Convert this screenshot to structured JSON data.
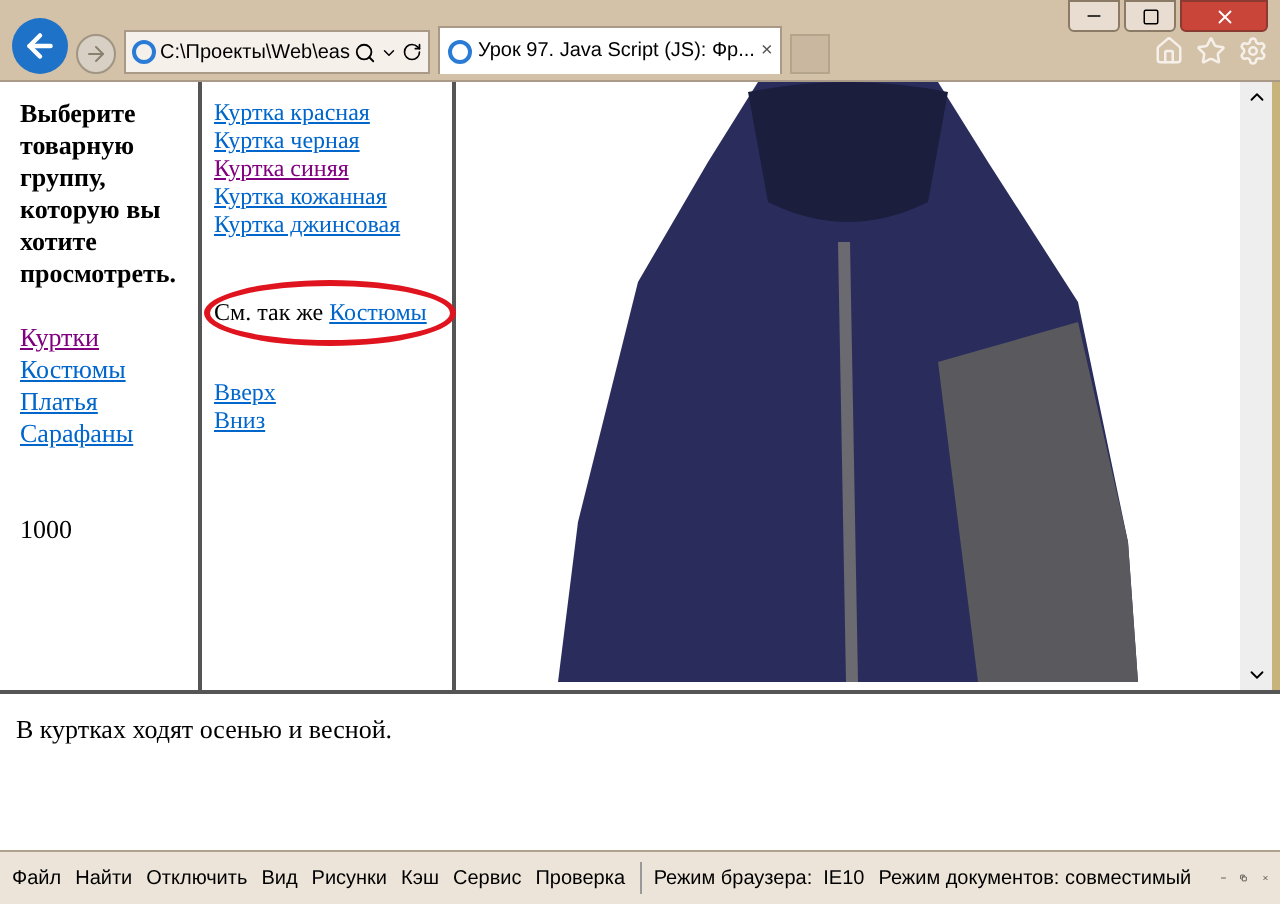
{
  "browser": {
    "address": "C:\\Проекты\\Web\\eas",
    "tab_title": "Урок 97. Java Script (JS): Фр...",
    "tab_close": "×"
  },
  "left_frame": {
    "heading": "Выберите товарную группу, которую вы хотите просмотреть.",
    "links": [
      {
        "label": "Куртки",
        "visited": true
      },
      {
        "label": "Костюмы",
        "visited": false
      },
      {
        "label": "Платья",
        "visited": false
      },
      {
        "label": "Сарафаны",
        "visited": false
      }
    ],
    "counter": "1000"
  },
  "middle_frame": {
    "links": [
      {
        "label": "Куртка красная",
        "visited": false
      },
      {
        "label": "Куртка черная",
        "visited": false
      },
      {
        "label": "Куртка синяя",
        "visited": true
      },
      {
        "label": "Куртка кожанная",
        "visited": false
      },
      {
        "label": "Куртка джинсовая",
        "visited": false
      }
    ],
    "see_also": {
      "text": "См. так же",
      "link": "Костюмы",
      "highlighted": true
    },
    "nav_links": [
      "Вверх",
      "Вниз"
    ]
  },
  "bottom_frame": {
    "text": "В куртках ходят осенью и весной."
  },
  "dev_toolbar": {
    "menu": [
      "Файл",
      "Найти",
      "Отключить",
      "Вид",
      "Рисунки",
      "Кэш",
      "Сервис",
      "Проверка"
    ],
    "browser_mode": "Режим браузера:  IE10",
    "document_mode": "Режим документов: совместимый"
  }
}
